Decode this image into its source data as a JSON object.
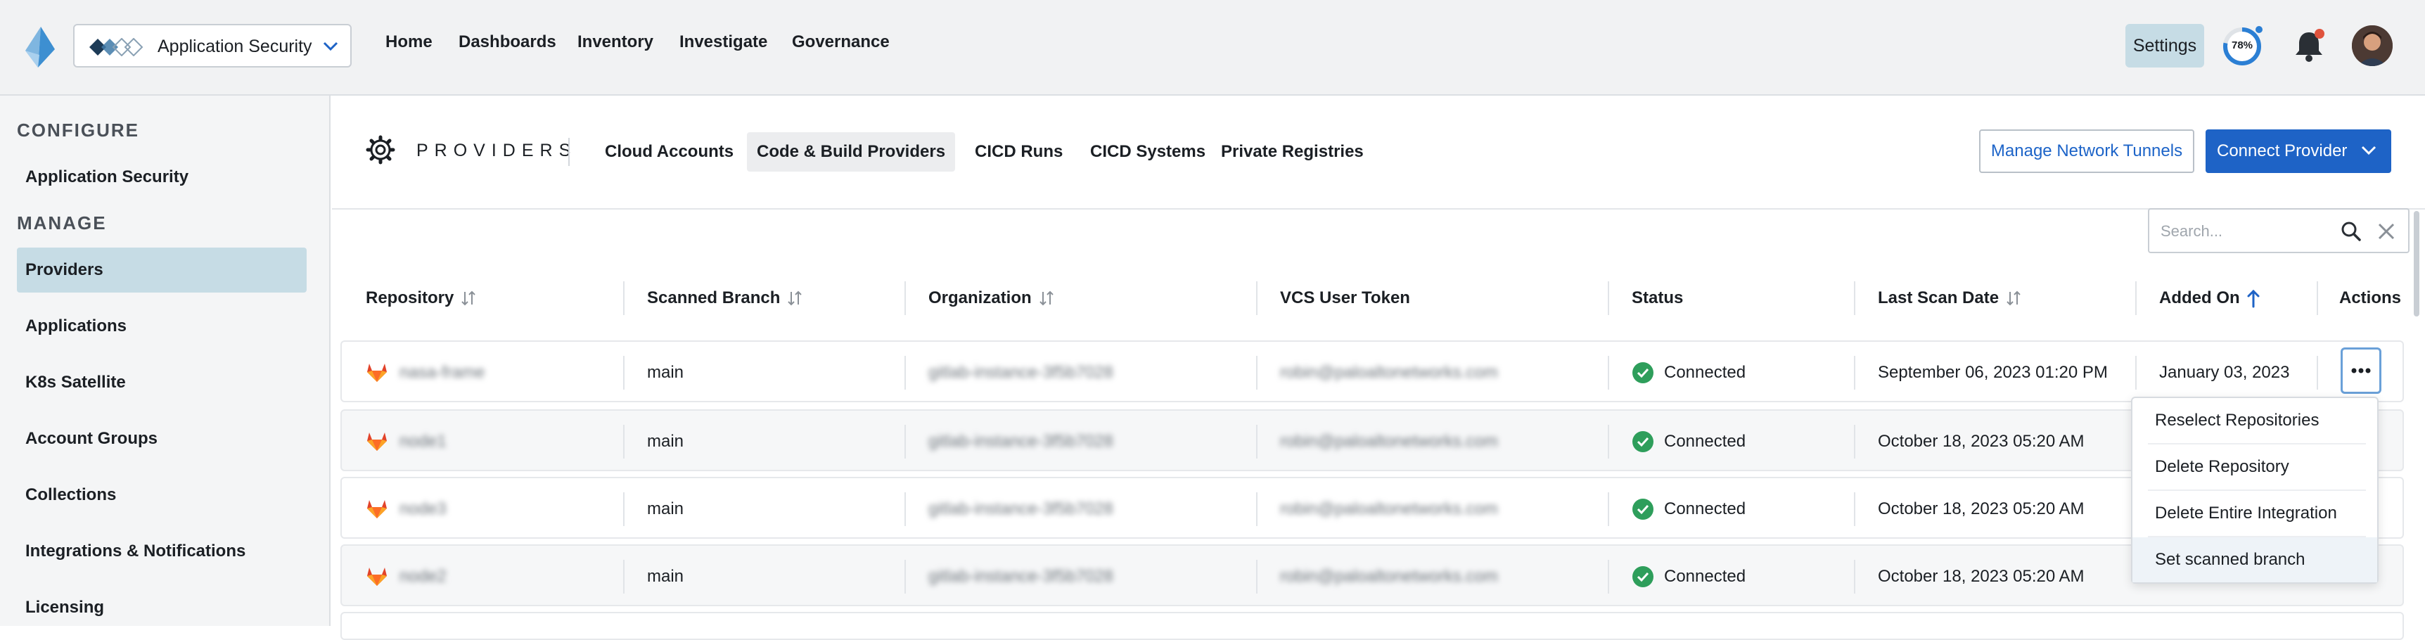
{
  "topbar": {
    "app_selector": "Application Security",
    "nav": [
      "Home",
      "Dashboards",
      "Inventory",
      "Investigate",
      "Governance"
    ],
    "settings_label": "Settings",
    "progress_label": "78%",
    "progress_value": 0.78,
    "progress_color": "#2b7fd4",
    "notification_dot_color": "#e0533d"
  },
  "sidebar": {
    "configure_heading": "CONFIGURE",
    "configure_items": [
      "Application Security"
    ],
    "manage_heading": "MANAGE",
    "manage_items": [
      "Providers",
      "Applications",
      "K8s Satellite",
      "Account Groups",
      "Collections",
      "Integrations & Notifications",
      "Licensing"
    ],
    "active_item": "Providers"
  },
  "subheader": {
    "title": "PROVIDERS",
    "tabs": [
      "Cloud Accounts",
      "Code & Build Providers",
      "CICD Runs",
      "CICD Systems",
      "Private Registries"
    ],
    "active_tab": "Code & Build Providers",
    "tunnel_button": "Manage Network Tunnels",
    "connect_button": "Connect Provider"
  },
  "search": {
    "placeholder": "Search..."
  },
  "table": {
    "headers": [
      "Repository",
      "Scanned Branch",
      "Organization",
      "VCS User Token",
      "Status",
      "Last Scan Date",
      "Added On",
      "Actions"
    ],
    "rows": [
      {
        "repository": "nasa-frame",
        "branch": "main",
        "organization": "gitlab-instance-3f5b7028",
        "token": "robin@paloaltonetworks.com",
        "status": "Connected",
        "last_scan": "September 06, 2023 01:20 PM",
        "added_on": "January 03, 2023"
      },
      {
        "repository": "node1",
        "branch": "main",
        "organization": "gitlab-instance-3f5b7028",
        "token": "robin@paloaltonetworks.com",
        "status": "Connected",
        "last_scan": "October 18, 2023 05:20 AM",
        "added_on": ""
      },
      {
        "repository": "node3",
        "branch": "main",
        "organization": "gitlab-instance-3f5b7028",
        "token": "robin@paloaltonetworks.com",
        "status": "Connected",
        "last_scan": "October 18, 2023 05:20 AM",
        "added_on": ""
      },
      {
        "repository": "node2",
        "branch": "main",
        "organization": "gitlab-instance-3f5b7028",
        "token": "robin@paloaltonetworks.com",
        "status": "Connected",
        "last_scan": "October 18, 2023 05:20 AM",
        "added_on": ""
      }
    ]
  },
  "actions_menu": {
    "items": [
      "Reselect Repositories",
      "Delete Repository",
      "Delete Entire Integration",
      "Set scanned branch"
    ],
    "highlighted": "Set scanned branch"
  },
  "colors": {
    "accent": "#1e63c6",
    "active_bg": "#c6dce5",
    "status_ok": "#2e9e5b",
    "gitlab": "#e2432a"
  }
}
